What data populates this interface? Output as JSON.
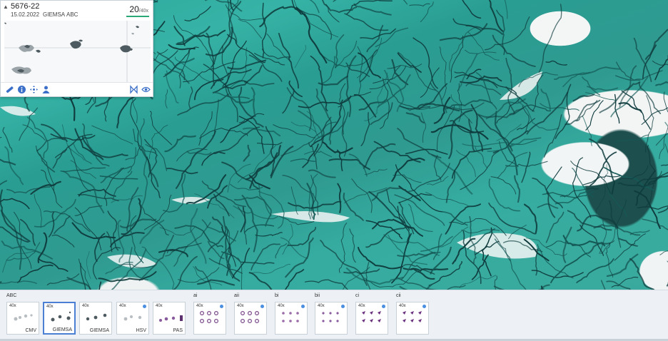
{
  "overview": {
    "case_id": "5676-22",
    "date": "15.02.2022",
    "stain": "GIEMSA",
    "block": "ABC",
    "zoom_value": "20",
    "zoom_max": "/40x",
    "collapse_icon": "chevron-up-icon"
  },
  "tools": [
    {
      "name": "ruler-icon"
    },
    {
      "name": "info-icon"
    },
    {
      "name": "move-icon"
    },
    {
      "name": "users-icon"
    },
    {
      "name": "flip-icon"
    },
    {
      "name": "eye-settings-icon"
    }
  ],
  "tray": {
    "groups": [
      {
        "label": "ABC"
      },
      {
        "label": "ai"
      },
      {
        "label": "aii"
      },
      {
        "label": "bi"
      },
      {
        "label": "bii"
      },
      {
        "label": "ci"
      },
      {
        "label": "cii"
      }
    ],
    "thumbs": [
      {
        "mag": "40x",
        "label": "CMV",
        "selected": false,
        "dot": false
      },
      {
        "mag": "40x",
        "label": "GIEMSA",
        "selected": true,
        "dot": false
      },
      {
        "mag": "40x",
        "label": "GIEMSA",
        "selected": false,
        "dot": false
      },
      {
        "mag": "40x",
        "label": "HSV",
        "selected": false,
        "dot": true
      },
      {
        "mag": "40x",
        "label": "PAS",
        "selected": false,
        "dot": false
      },
      {
        "mag": "40x",
        "label": "",
        "selected": false,
        "dot": true
      },
      {
        "mag": "40x",
        "label": "",
        "selected": false,
        "dot": true
      },
      {
        "mag": "40x",
        "label": "",
        "selected": false,
        "dot": true
      },
      {
        "mag": "40x",
        "label": "",
        "selected": false,
        "dot": true
      },
      {
        "mag": "40x",
        "label": "",
        "selected": false,
        "dot": true
      },
      {
        "mag": "40x",
        "label": "",
        "selected": false,
        "dot": true
      }
    ]
  },
  "colors": {
    "tissue": "#2ea89c",
    "fiber": "#0f3b3d",
    "accent": "#4a7fd4",
    "zoom_bar": "#2aa876"
  }
}
